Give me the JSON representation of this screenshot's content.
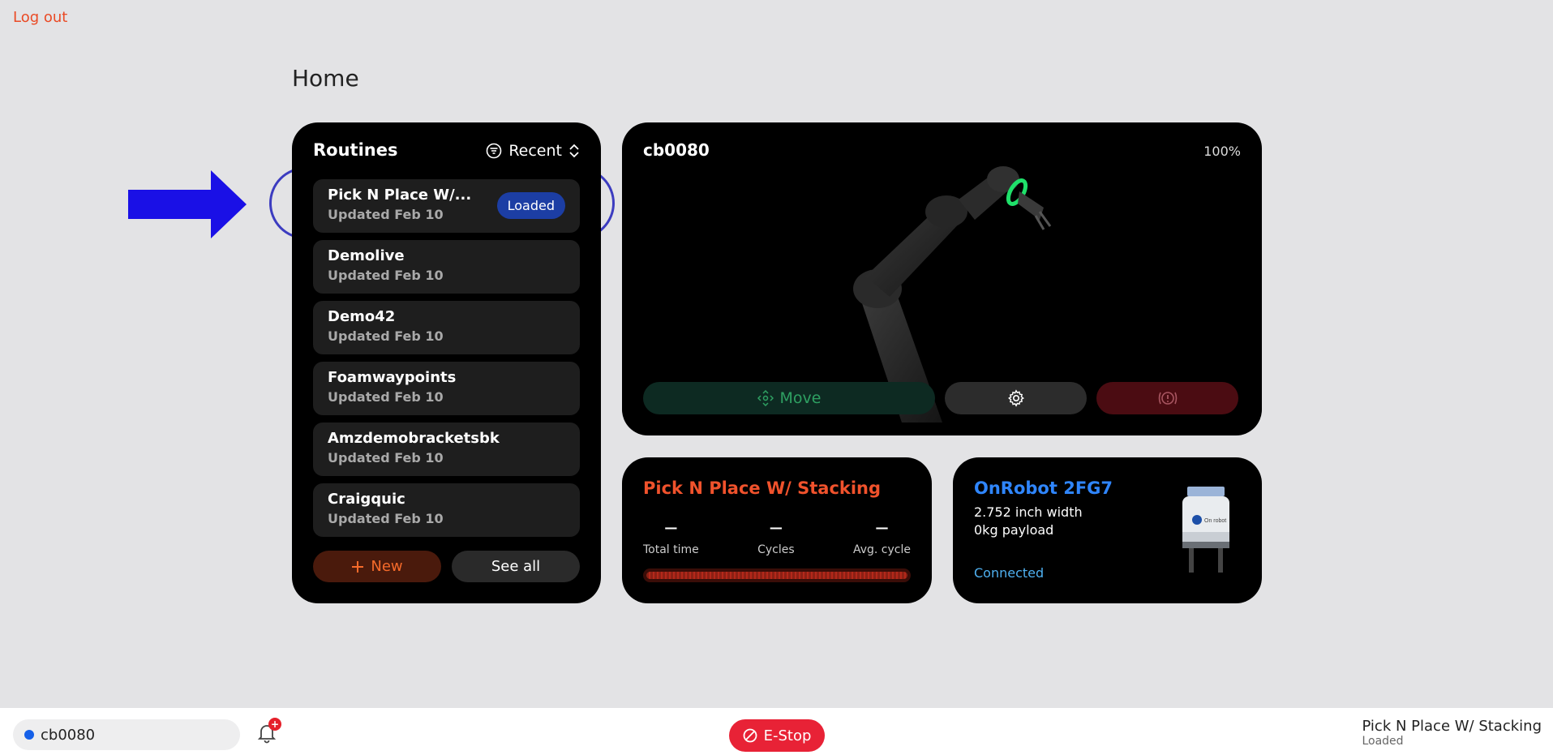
{
  "header": {
    "logout_label": "Log out",
    "page_title": "Home"
  },
  "routines": {
    "title": "Routines",
    "sort_label": "Recent",
    "items": [
      {
        "name": "Pick N Place W/...",
        "updated": "Updated Feb 10",
        "badge": "Loaded"
      },
      {
        "name": "Demolive",
        "updated": "Updated Feb 10"
      },
      {
        "name": "Demo42",
        "updated": "Updated Feb 10"
      },
      {
        "name": "Foamwaypoints",
        "updated": "Updated Feb 10"
      },
      {
        "name": "Amzdemobracketsbk",
        "updated": "Updated Feb 10"
      },
      {
        "name": "Craigquic",
        "updated": "Updated Feb 10"
      }
    ],
    "new_label": "New",
    "see_all_label": "See all"
  },
  "robot": {
    "name": "cb0080",
    "speed": "100%",
    "move_label": "Move"
  },
  "program": {
    "title": "Pick N Place W/ Stacking",
    "stats": [
      {
        "value": "—",
        "label": "Total time"
      },
      {
        "value": "—",
        "label": "Cycles"
      },
      {
        "value": "—",
        "label": "Avg. cycle"
      }
    ]
  },
  "gripper": {
    "name": "OnRobot 2FG7",
    "width": "2.752 inch width",
    "payload": "0kg payload",
    "status": "Connected",
    "logo_text": "On robot"
  },
  "bottom_bar": {
    "robot_name": "cb0080",
    "notification_count": "+",
    "estop_label": "E-Stop",
    "current_program": "Pick N Place W/ Stacking",
    "current_status": "Loaded"
  },
  "colors": {
    "accent_orange": "#f0522c",
    "accent_blue": "#2f86ff",
    "estop_red": "#e82236",
    "loaded_badge": "#1c3ea4",
    "annotation": "#1a10e6"
  }
}
